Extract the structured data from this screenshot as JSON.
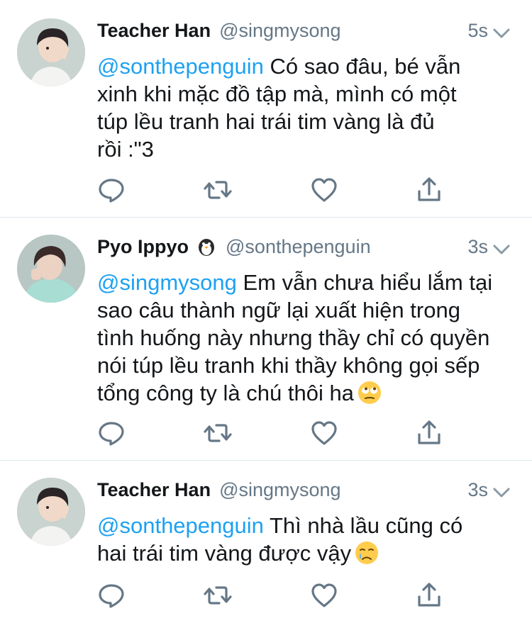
{
  "tweets": [
    {
      "name": "Teacher Han",
      "handle": "@singmysong",
      "time": "5s",
      "mention": "@sonthepenguin",
      "lines": [
        " Có sao đâu, bé vẫn",
        "xinh khi mặc đồ tập mà, mình có một",
        "túp lều tranh hai trái tim vàng là đủ",
        "rồi :\"3"
      ],
      "name_emoji": "",
      "text_emoji": ""
    },
    {
      "name": "Pyo Ippyo",
      "handle": "@sonthepenguin",
      "time": "3s",
      "mention": "@singmysong",
      "lines": [
        " Em vẫn chưa hiểu lắm tại",
        "sao câu thành ngữ lại xuất hiện trong",
        "tình huống này nhưng thầy chỉ có quyền",
        "nói túp lều tranh khi thầy không gọi sếp",
        "tổng công ty là chú thôi ha"
      ],
      "name_emoji": "penguin-emoji",
      "text_emoji": "eye-roll-emoji"
    },
    {
      "name": "Teacher Han",
      "handle": "@singmysong",
      "time": "3s",
      "mention": "@sonthepenguin",
      "lines": [
        " Thì nhà lầu cũng có",
        "hai trái tim vàng được vậy"
      ],
      "name_emoji": "",
      "text_emoji": "crying-emoji"
    }
  ],
  "icons": [
    "reply-icon",
    "retweet-icon",
    "like-icon",
    "share-icon",
    "chevron-down-icon"
  ],
  "colors": {
    "accent": "#1da1f2",
    "muted": "#657786",
    "icon": "#657786",
    "divider": "#e1e8ed"
  }
}
